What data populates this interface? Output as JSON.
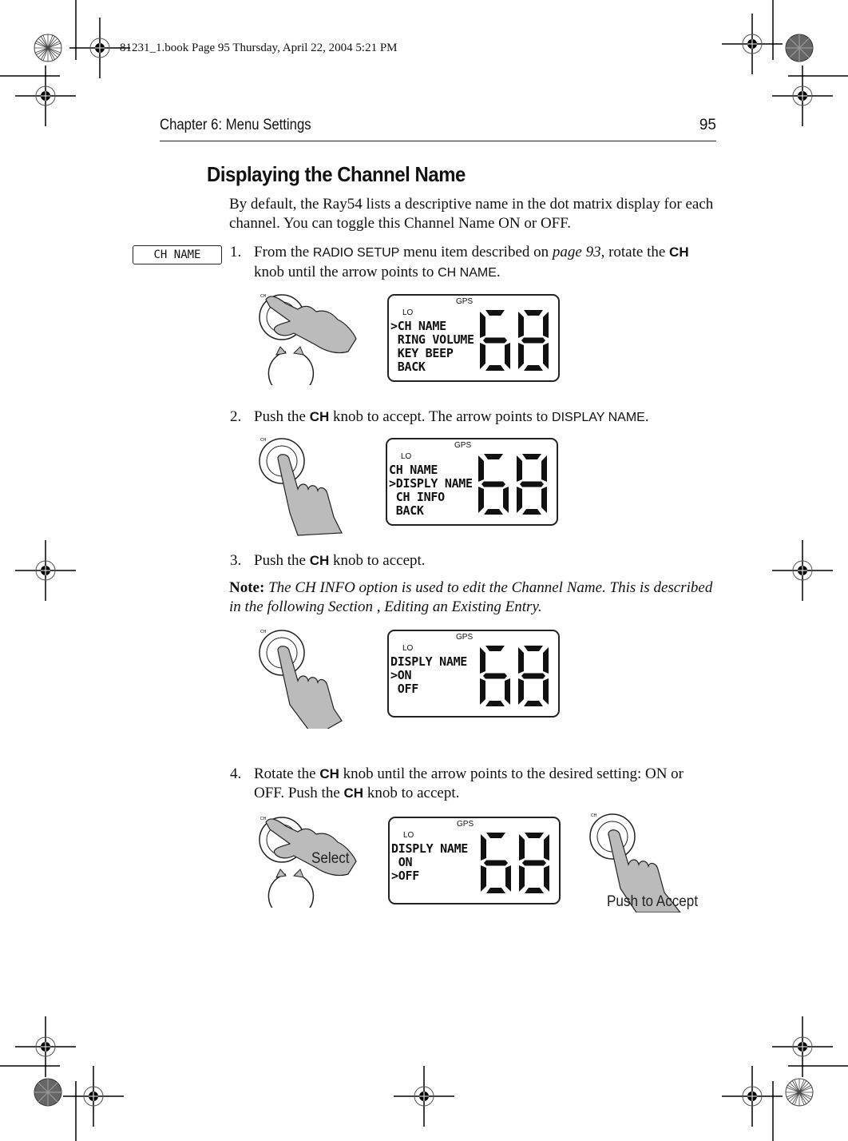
{
  "print_stamp": "81231_1.book  Page 95  Thursday, April 22, 2004  5:21 PM",
  "header": {
    "chapter": "Chapter 6: Menu Settings",
    "page_number": "95"
  },
  "section_title": "Displaying the Channel Name",
  "intro": "By default, the Ray54 lists a descriptive name in the dot matrix display for each channel. You can toggle this Channel Name ON or OFF.",
  "margin_tag": "CH NAME",
  "steps": [
    {
      "num": "1.",
      "parts": [
        "From the ",
        "RADIO SETUP",
        " menu item described on ",
        "page 93",
        ", rotate the ",
        "CH",
        " knob until the arrow points to ",
        "CH NAME",
        "."
      ]
    },
    {
      "num": "2.",
      "parts": [
        "Push the ",
        "CH",
        " knob to accept. The arrow points to ",
        "DISPLAY NAME",
        "."
      ]
    },
    {
      "num": "3.",
      "parts": [
        "Push the ",
        "CH",
        " knob to accept."
      ]
    },
    {
      "num": "4.",
      "parts": [
        "Rotate the ",
        "CH",
        " knob until the arrow points to the desired setting: ON or OFF. Push the ",
        "CH",
        " knob to accept."
      ]
    }
  ],
  "note": {
    "label": "Note:",
    "text": "The CH INFO option is used to edit the Channel Name. This is described in the following Section , Editing an Existing Entry."
  },
  "displays": [
    {
      "gps": "GPS",
      "lo": "LO",
      "channel": "68",
      "lines": [
        ">CH NAME",
        " RING VOLUME",
        " KEY BEEP",
        " BACK"
      ]
    },
    {
      "gps": "GPS",
      "lo": "LO",
      "channel": "68",
      "lines": [
        "CH NAME",
        ">DISPLY NAME",
        " CH INFO",
        " BACK"
      ]
    },
    {
      "gps": "GPS",
      "lo": "LO",
      "channel": "68",
      "lines": [
        "DISPLY NAME",
        ">ON",
        " OFF"
      ]
    },
    {
      "gps": "GPS",
      "lo": "LO",
      "channel": "68",
      "lines": [
        "DISPLY NAME",
        " ON",
        ">OFF"
      ]
    }
  ],
  "knob": {
    "label": "CH",
    "ring_text": "PUSH TO ACCEPT"
  },
  "callouts": {
    "select": "Select",
    "push_to_accept": "Push to Accept"
  }
}
